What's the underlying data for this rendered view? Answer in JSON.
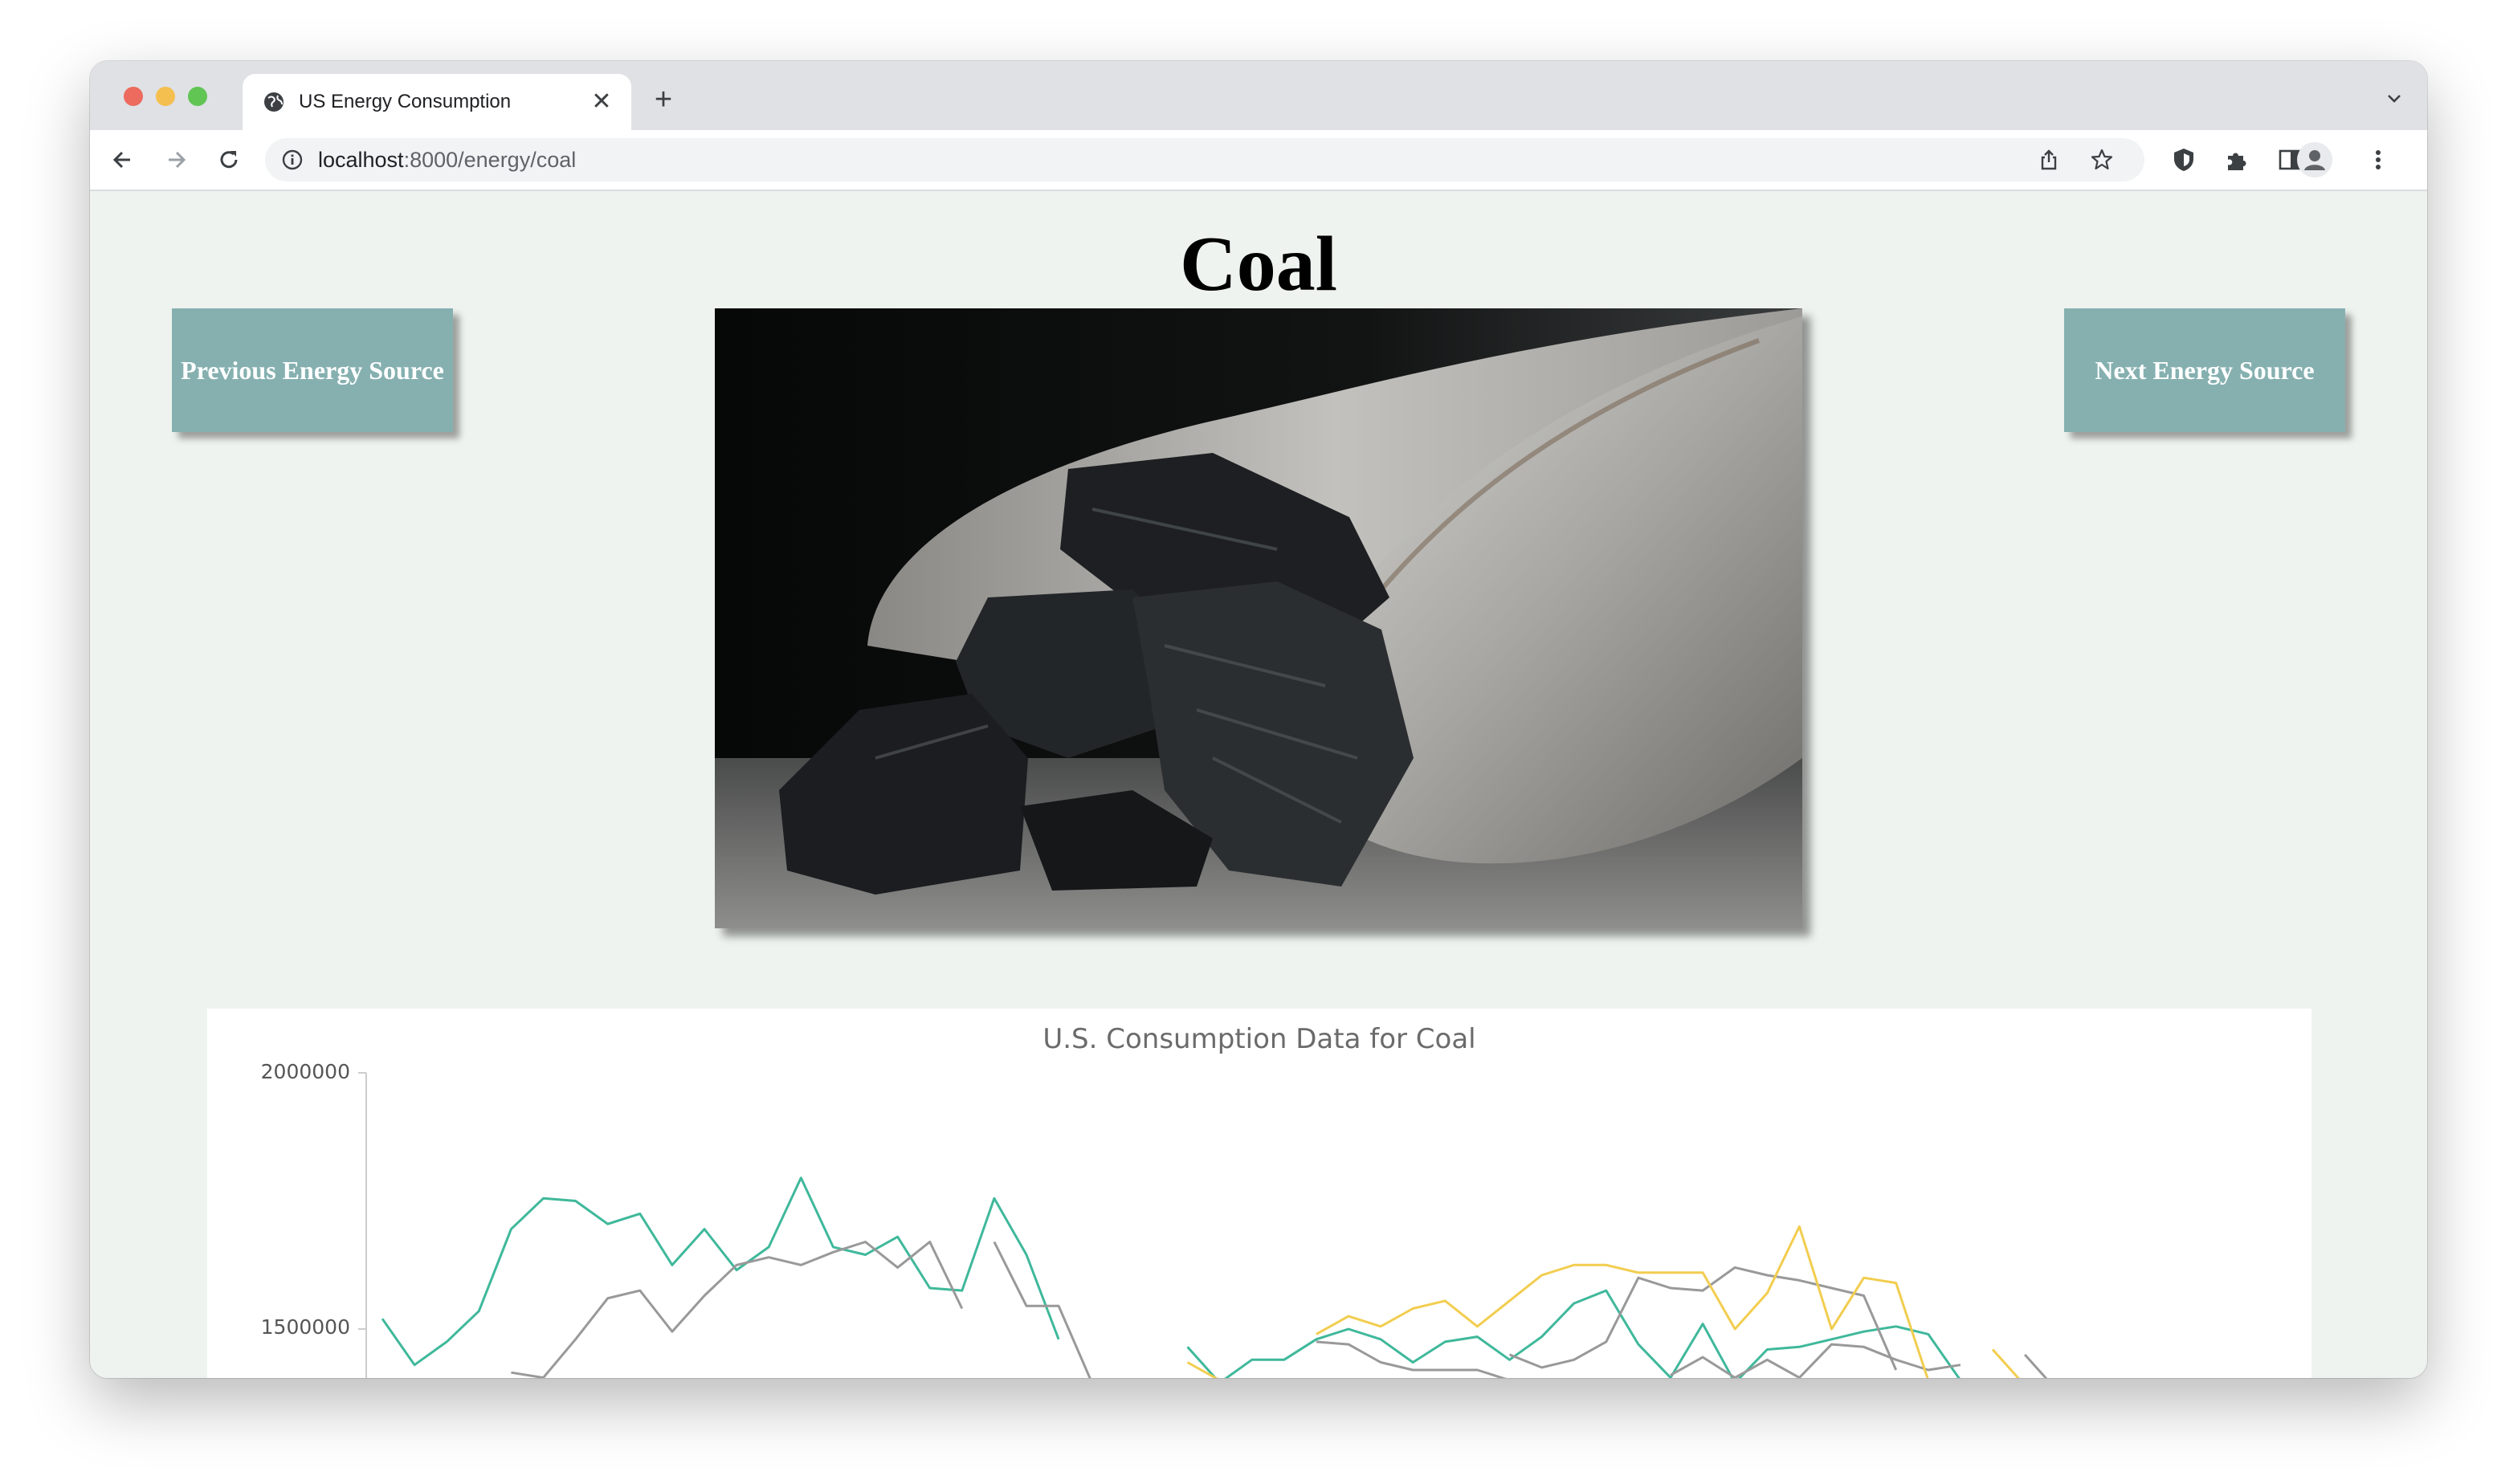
{
  "browser": {
    "tab_title": "US Energy Consumption",
    "url_host": "localhost",
    "url_path": ":8000/energy/coal",
    "icons": [
      "globe-icon",
      "close-icon",
      "plus-icon",
      "back-icon",
      "forward-icon",
      "reload-icon",
      "info-icon",
      "share-icon",
      "star-icon",
      "shield-icon",
      "puzzle-icon",
      "sidebar-icon",
      "avatar-icon",
      "menu-icon",
      "chevron-down-icon"
    ]
  },
  "page": {
    "title": "Coal",
    "prev_button": "Previous Energy Source",
    "next_button": "Next Energy Source",
    "image_alt": "coal-on-metal-scoop"
  },
  "chart_data": {
    "type": "line",
    "title": "U.S. Consumption Data for Coal",
    "y_ticks": [
      "2000000",
      "1500000"
    ],
    "ylim_visible": [
      1430000,
      2000000
    ],
    "colors": [
      "#3fb89b",
      "#999999",
      "#999999",
      "#f2cd4f"
    ],
    "series": [
      {
        "color": "#3fb89b",
        "values": [
          1520000,
          1430000,
          1475000,
          1535000,
          1695000,
          1755000,
          1750000,
          1705000,
          1725000,
          1625000,
          1695000,
          1615000,
          1660000,
          1795000,
          1660000,
          1645000,
          1680000,
          1580000,
          1575000,
          1755000,
          1645000,
          1480000,
          null,
          null,
          null,
          1465000,
          1395000,
          1440000,
          1440000,
          1480000,
          1500000,
          1480000,
          1435000,
          1475000,
          1485000,
          1440000,
          1485000,
          1550000,
          1575000,
          1470000,
          1405000,
          1510000,
          1395000,
          1460000,
          1465000,
          1480000,
          1495000,
          1505000,
          1490000,
          1400000
        ]
      },
      {
        "color": "#999999",
        "values": [
          null,
          null,
          null,
          null,
          null,
          null,
          null,
          null,
          null,
          null,
          null,
          null,
          null,
          null,
          null,
          null,
          null,
          null,
          null,
          1670000,
          1545000,
          1545000,
          1400000,
          null,
          null,
          null,
          null,
          null,
          null,
          1475000,
          1470000,
          1435000,
          1420000,
          1420000,
          1420000,
          1400000,
          null,
          null,
          null,
          null,
          1410000,
          1445000,
          1405000,
          1440000,
          1405000,
          1470000,
          1465000,
          1440000,
          1420000,
          1430000,
          null,
          1450000,
          1380000
        ]
      },
      {
        "color": "#999999",
        "values": [
          null,
          null,
          null,
          null,
          1415000,
          1405000,
          1480000,
          1560000,
          1575000,
          1495000,
          1565000,
          1625000,
          1640000,
          1625000,
          1650000,
          1670000,
          1620000,
          1670000,
          1540000,
          null,
          null,
          null,
          null,
          null,
          null,
          null,
          null,
          null,
          null,
          null,
          null,
          null,
          null,
          null,
          null,
          1450000,
          1425000,
          1440000,
          1475000,
          1600000,
          1580000,
          1575000,
          1620000,
          1605000,
          1595000,
          1580000,
          1565000,
          1420000
        ]
      },
      {
        "color": "#f2cd4f",
        "values": [
          null,
          null,
          null,
          null,
          null,
          null,
          null,
          null,
          null,
          null,
          null,
          null,
          null,
          null,
          null,
          null,
          null,
          null,
          null,
          null,
          null,
          null,
          null,
          null,
          null,
          1435000,
          1400000,
          null,
          null,
          1490000,
          1525000,
          1505000,
          1540000,
          1555000,
          1505000,
          1555000,
          1605000,
          1625000,
          1625000,
          1610000,
          1610000,
          1610000,
          1500000,
          1570000,
          1700000,
          1500000,
          1600000,
          1590000,
          1400000,
          null,
          1460000,
          1390000
        ]
      }
    ]
  }
}
